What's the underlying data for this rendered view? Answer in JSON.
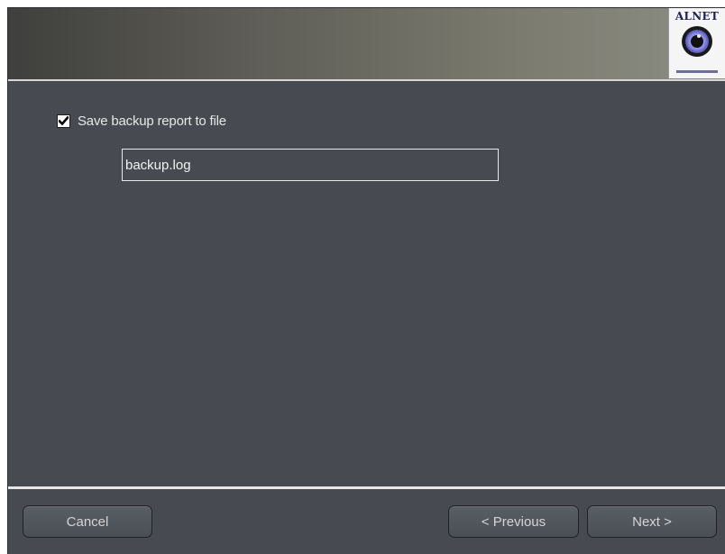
{
  "banner": {
    "logo_text": "ALNET",
    "logo_icon": "eye-icon"
  },
  "options": {
    "save_report_label": "Save backup report to file",
    "save_report_checked": true,
    "filename_value": "backup.log"
  },
  "footer": {
    "cancel_label": "Cancel",
    "previous_label": "< Previous",
    "next_label": "Next >"
  },
  "colors": {
    "panel_background": "#474b51",
    "banner_gradient_start": "#3f3f3d",
    "banner_gradient_end": "#8d8e84",
    "text": "#e6e6e6"
  }
}
